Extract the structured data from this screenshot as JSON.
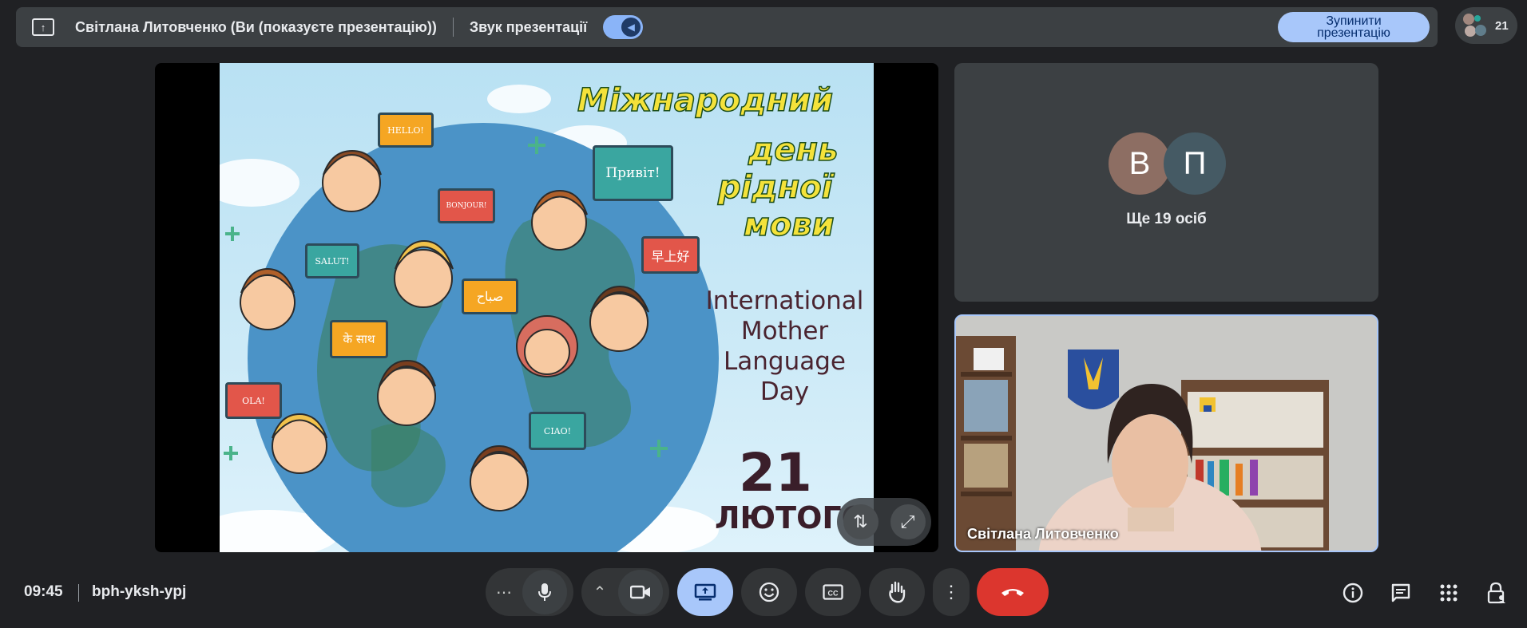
{
  "topbar": {
    "presenter_text": "Світлана Литовченко (Ви (показуєте презентацію))",
    "sound_label": "Звук презентації",
    "sound_toggle_on": true,
    "stop_button": "Зупинити презентацію"
  },
  "people": {
    "count": "21"
  },
  "slide": {
    "title_lines": [
      "Міжнародний",
      "день",
      "рідної",
      "мови"
    ],
    "english_lines": [
      "International",
      "Mother",
      "Language",
      "Day"
    ],
    "date_number": "21",
    "date_month": "ЛЮТОГО",
    "bubbles": [
      "HELLO!",
      "Привіт!",
      "BONJOUR!",
      "SALUT!",
      "早上好",
      "صباح",
      "के साथ",
      "OLA!",
      "CIAO!"
    ]
  },
  "participants": {
    "avatars": [
      {
        "letter": "В",
        "color": "#8d6e63"
      },
      {
        "letter": "П",
        "color": "#455a64"
      }
    ],
    "others_label": "Ще 19 осіб",
    "camera_name": "Світлана Литовченко"
  },
  "bottom": {
    "time": "09:45",
    "meeting_code": "bph-yksh-ypj"
  },
  "colors": {
    "background": "#202124",
    "accent": "#a8c7fa",
    "end_call": "#dc362e"
  }
}
